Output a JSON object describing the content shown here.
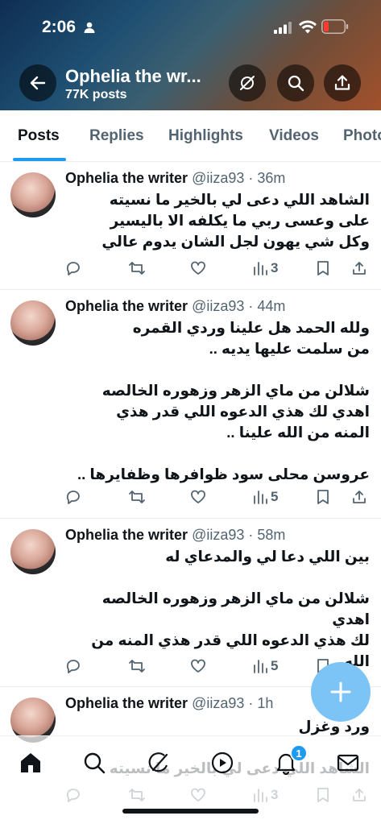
{
  "status_bar": {
    "time": "2:06"
  },
  "header": {
    "profile_name": "Ophelia the wr...",
    "post_count": "77K posts"
  },
  "tabs": [
    {
      "label": "Posts",
      "active": true
    },
    {
      "label": "Replies"
    },
    {
      "label": "Highlights"
    },
    {
      "label": "Videos"
    },
    {
      "label": "Photo"
    }
  ],
  "tweets": [
    {
      "author": "Ophelia the writer",
      "meta": "@iiza93 · 36m",
      "text": "الشاهد اللي دعى لي بالخير ما نسيته\nعلى وعسى ربي ما يكلفه الا باليسير\nوكل شي يهون لجل الشان يدوم عالي",
      "views": "3"
    },
    {
      "author": "Ophelia the writer",
      "meta": "@iiza93 · 44m",
      "text": "ولله الحمد هل علينا وردي القمره\nمن سلمت عليها يديه ..\n\nشلالن من ماي الزهر وزهوره الخالصه\nاهدي لك هذي الدعوه اللي قدر هذي\nالمنه من الله علينا ..\n\nعروسن محلى سود ظوافرها وظفايرها ..",
      "views": "5"
    },
    {
      "author": "Ophelia the writer",
      "meta": "@iiza93 · 58m",
      "text": "بين اللي دعا لي والمدعاي له\n\nشلالن من ماي الزهر وزهوره الخالصه اهدي\nلك هذي الدعوه اللي قدر هذي المنه من الله\nعلينا ..",
      "views": "5"
    },
    {
      "author": "Ophelia the writer",
      "meta": "@iiza93 · 1h",
      "text": "ورد وغزل\n\nالشاهد اللي دعى لي بالخير ما نسيته",
      "views": "3"
    }
  ],
  "bottom_nav": {
    "notifications_badge": "1"
  }
}
